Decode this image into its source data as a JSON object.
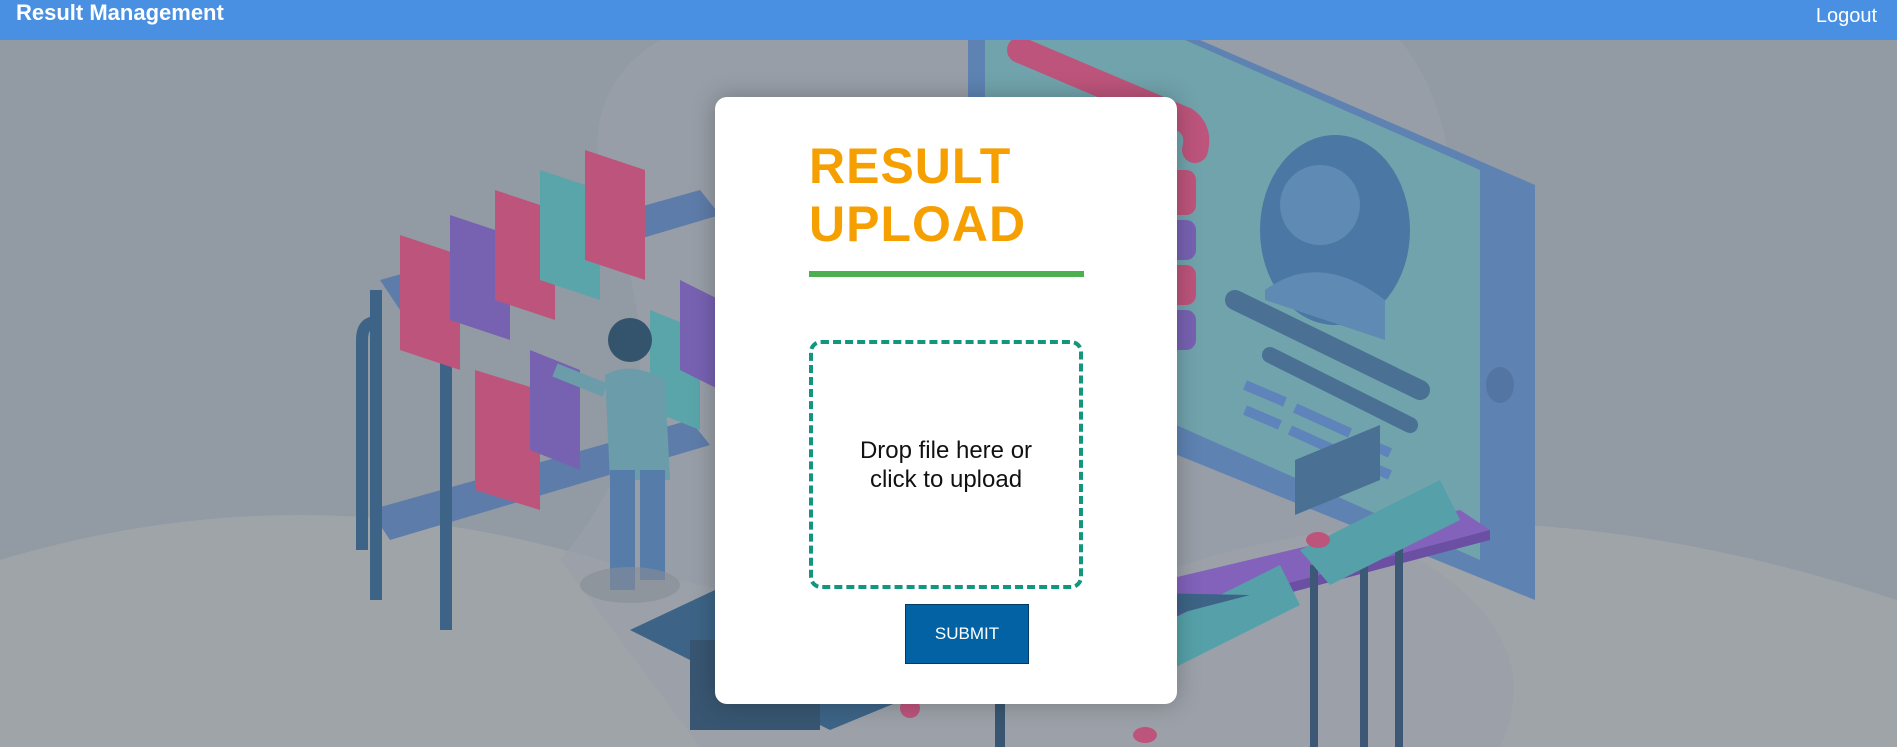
{
  "navbar": {
    "brand": "Result Management",
    "logout_label": "Logout",
    "color": "#4a90e2"
  },
  "card": {
    "title": "RESULT UPLOAD",
    "title_color": "#f5a000",
    "rule_color": "#4caf50",
    "dropzone_text": "Drop file here or click to upload",
    "dropzone_border_color": "#12967d",
    "submit_label": "SUBMIT",
    "submit_color": "#0262a4"
  },
  "background": {
    "illustration": "library-and-online-profile-illustration"
  }
}
